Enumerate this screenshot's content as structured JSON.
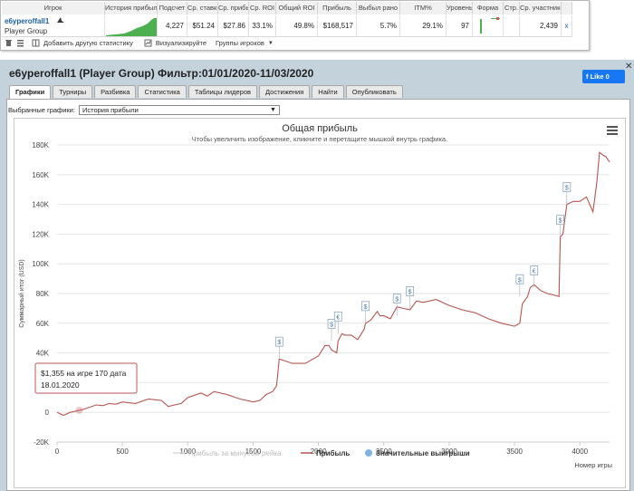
{
  "table": {
    "headers": [
      "Игрок",
      "История прибыли",
      "Подсчет",
      "Ср. ставка",
      "Ср. прибыль",
      "Ср. ROI",
      "Общий ROI",
      "Прибыль",
      "Выбыл рано",
      "ITM%",
      "Уровень",
      "Форма",
      "Стр.",
      "Ср. участников"
    ],
    "row": {
      "player": "e6yperoffall1",
      "group": "Player Group",
      "count": "4,227",
      "avg_stake": "$51.24",
      "avg_profit": "$27.86",
      "avg_roi": "33.1%",
      "total_roi": "49.8%",
      "profit": "$168,517",
      "early": "5.7%",
      "itm": "29.1%",
      "level": "97",
      "entrants": "2,439"
    }
  },
  "toolbar": {
    "add_stat": "Добавить другую статистику",
    "visualize": "Визуализируйте",
    "groups": "Группы игроков"
  },
  "main": {
    "title": "e6yperoffall1 (Player Group) Фильтр:01/01/2020-11/03/2020",
    "like": "Like 0",
    "tabs": [
      "Графики",
      "Турниры",
      "Разбивка",
      "Статистика",
      "Таблицы лидеров",
      "Достижения",
      "Найти",
      "Опубликовать"
    ],
    "selected_label": "Выбранные графики:",
    "selected_value": "История прибыли"
  },
  "chart_data": {
    "type": "line",
    "title": "Общая прибыль",
    "subtitle": "Чтобы увеличить изображение, кликните и перетащите мышкой внутрь графика.",
    "ylabel": "Суммарный итог (USD)",
    "xlabel": "Номер игры",
    "xlim": [
      0,
      4227
    ],
    "ylim": [
      -20000,
      180000
    ],
    "xticks": [
      0,
      500,
      1000,
      1500,
      2000,
      2500,
      3000,
      3500,
      4000
    ],
    "yticks": [
      -20000,
      0,
      20000,
      40000,
      60000,
      80000,
      100000,
      120000,
      140000,
      160000,
      180000
    ],
    "ytick_labels": [
      "-20K",
      "0",
      "20K",
      "40K",
      "60K",
      "80K",
      "100K",
      "120K",
      "140K",
      "160K",
      "180K"
    ],
    "legend": [
      "Прибыль за минусом рейка",
      "Прибыль",
      "Значительные выигрыши"
    ],
    "legend_position": "bottom",
    "tooltip_line1": "$1,355 на игре 170 дата",
    "tooltip_line2": "18.01.2020",
    "tooltip_point": {
      "x": 170,
      "y": 1355
    },
    "series": [
      {
        "name": "Прибыль",
        "color": "#b85450",
        "x": [
          0,
          50,
          100,
          150,
          170,
          200,
          250,
          300,
          350,
          400,
          450,
          500,
          600,
          700,
          800,
          850,
          900,
          950,
          1000,
          1100,
          1150,
          1200,
          1300,
          1400,
          1500,
          1550,
          1600,
          1650,
          1680,
          1700,
          1800,
          1900,
          2000,
          2050,
          2080,
          2100,
          2140,
          2150,
          2180,
          2200,
          2250,
          2300,
          2350,
          2360,
          2400,
          2450,
          2470,
          2500,
          2550,
          2600,
          2650,
          2700,
          2750,
          2800,
          2900,
          3000,
          3100,
          3200,
          3300,
          3400,
          3500,
          3540,
          3560,
          3600,
          3620,
          3650,
          3700,
          3750,
          3800,
          3840,
          3850,
          3870,
          3900,
          3950,
          4000,
          4050,
          4100,
          4130,
          4150,
          4180,
          4200,
          4227
        ],
        "y": [
          0,
          -2000,
          0,
          1000,
          1355,
          2000,
          3500,
          5000,
          4500,
          6000,
          5500,
          7000,
          6000,
          9000,
          8000,
          4000,
          5000,
          6000,
          10000,
          13000,
          11000,
          14000,
          12000,
          9000,
          7000,
          8000,
          12000,
          14000,
          18000,
          36000,
          33000,
          33000,
          38000,
          45000,
          45000,
          42000,
          40000,
          48000,
          53000,
          52000,
          52000,
          49000,
          56000,
          60000,
          62000,
          68000,
          65000,
          65000,
          63000,
          71000,
          70000,
          69000,
          75000,
          74000,
          76000,
          72000,
          69000,
          67000,
          63000,
          60000,
          58000,
          60000,
          73000,
          78000,
          84000,
          86000,
          82000,
          80000,
          79000,
          78000,
          118000,
          120000,
          140000,
          142000,
          142000,
          145000,
          135000,
          155000,
          175000,
          173000,
          172000,
          168517
        ]
      }
    ],
    "big_wins": {
      "x": [
        1700,
        2100,
        2150,
        2360,
        2600,
        2700,
        3540,
        3650,
        3850,
        3900
      ],
      "y": [
        36000,
        48000,
        53000,
        60000,
        65000,
        70000,
        78000,
        84000,
        118000,
        140000
      ],
      "labels": [
        "$",
        "$",
        "€",
        "$",
        "$",
        "$",
        "$",
        "€",
        "$",
        "$"
      ]
    }
  }
}
